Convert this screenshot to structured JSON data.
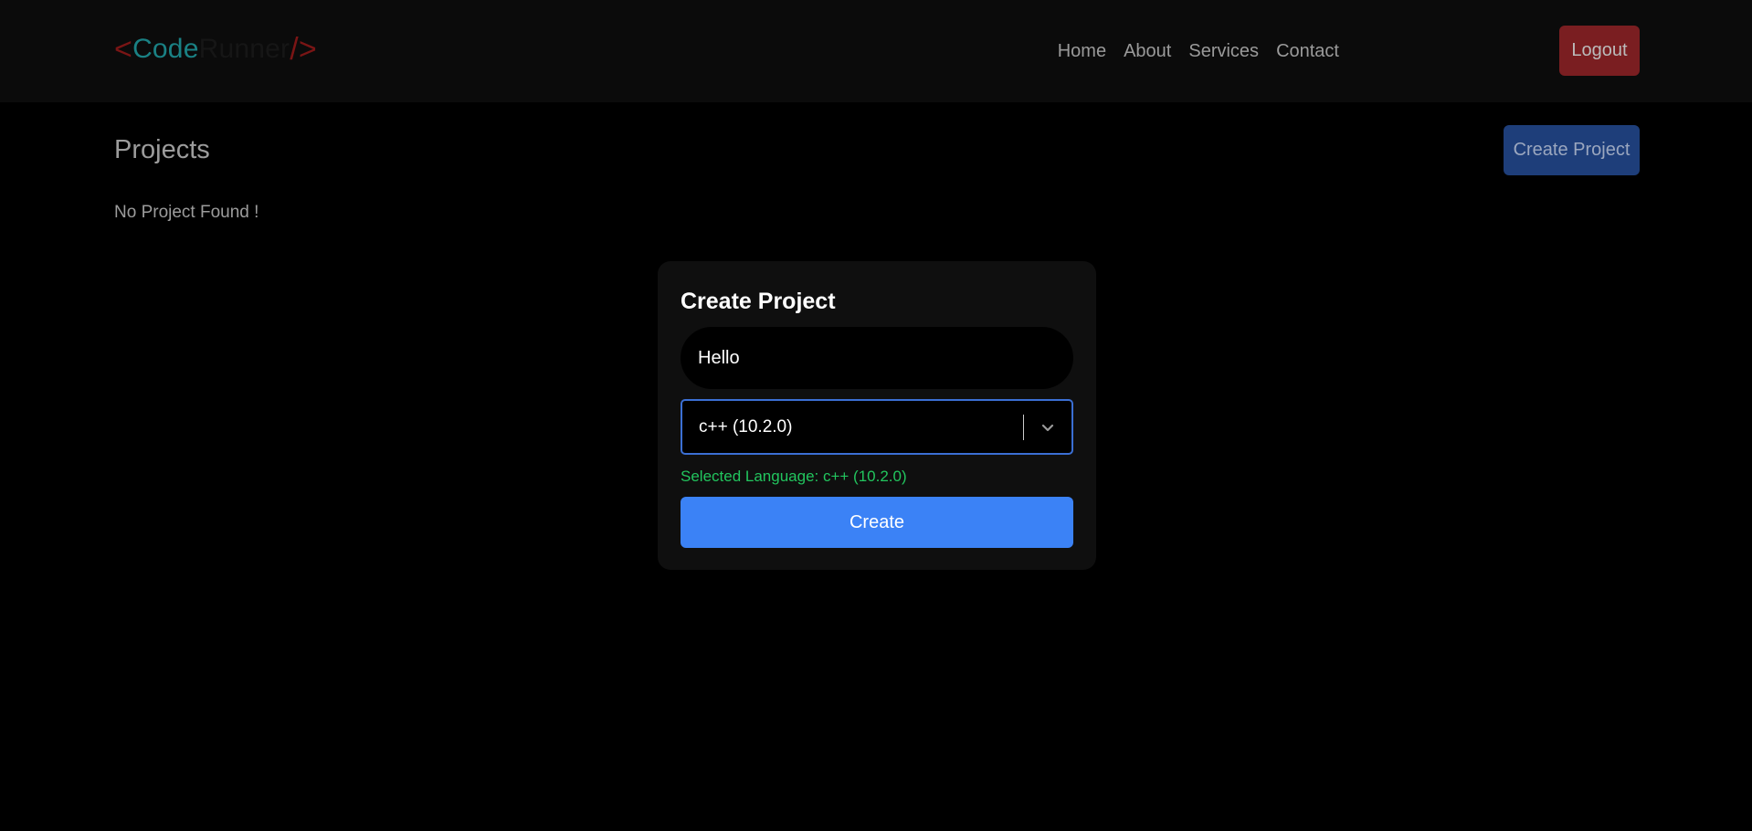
{
  "navbar": {
    "logo": {
      "open_bracket": "<",
      "code": "Code",
      "runner": "Runner",
      "close_bracket": "/>"
    },
    "links": [
      "Home",
      "About",
      "Services",
      "Contact"
    ],
    "logout_label": "Logout"
  },
  "projects": {
    "title": "Projects",
    "create_button_label": "Create Project",
    "empty_message": "No Project Found !"
  },
  "modal": {
    "title": "Create Project",
    "name_value": "Hello",
    "language_value": "c++ (10.2.0)",
    "selected_language_text": "Selected Language: c++ (10.2.0)",
    "create_label": "Create"
  },
  "colors": {
    "background": "#000000",
    "navbar": "#0b0b0b",
    "logout": "#7a1e21",
    "create_project": "#1e3e7a",
    "primary": "#3b82f6",
    "success": "#22c55e",
    "logo_code": "#1a8184",
    "logo_bracket": "#7a1515"
  },
  "icons": {
    "dropdown": "chevron-down-icon"
  }
}
